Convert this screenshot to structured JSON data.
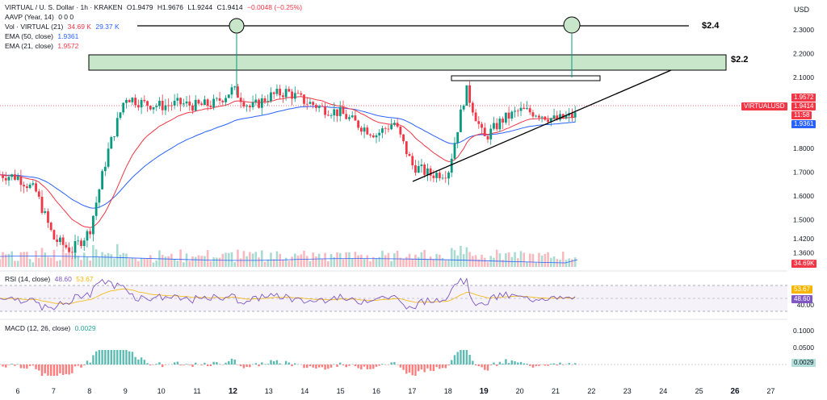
{
  "header": {
    "title": "VIRTUAL / U. S. Dollar · 1h · KRAKEN",
    "o": "O1.9479",
    "h": "H1.9676",
    "l": "L1.9244",
    "c": "C1.9414",
    "chg": "−0.0048 (−0.25%)",
    "currency": "USD"
  },
  "indicators": {
    "aavp": {
      "label": "AAVP (Year, 14)",
      "values": "0  0  0"
    },
    "vol": {
      "label": "Vol · VIRTUAL (21)",
      "v1": "34.69 K",
      "v2": "29.37 K"
    },
    "ema50": {
      "label": "EMA (50, close)",
      "value": "1.9361"
    },
    "ema21": {
      "label": "EMA (21, close)",
      "value": "1.9572"
    },
    "rsi": {
      "label": "RSI (14, close)",
      "v1": "48.60",
      "v2": "53.67"
    },
    "macd": {
      "label": "MACD (12, 26, close)",
      "value": "0.0029"
    }
  },
  "annotations": {
    "top_level": "$2.4",
    "resistance": "$2.2"
  },
  "price_tags": {
    "ema21": "1.9572",
    "symbol": "VIRTUALUSD",
    "last": "1.9414",
    "countdown": "11:58",
    "ema50": "1.9361",
    "volume": "34.69K",
    "rsi_a": "53.67",
    "rsi_b": "48.60",
    "macd": "0.0029"
  },
  "colors": {
    "up": "#089981",
    "down": "#f23645",
    "ema50": "#2962ff",
    "ema21": "#f23645",
    "rsi": "#7e57c2",
    "rsi_ma": "#f7b500",
    "zone": "#c8e6c9"
  },
  "chart_data": {
    "type": "candlestick",
    "symbol": "VIRTUAL / U. S. Dollar",
    "interval": "1h",
    "price_axis_labels": [
      "2.3000",
      "2.2000",
      "2.1000",
      "1.8000",
      "1.7000",
      "1.6000",
      "1.5000",
      "1.4200",
      "1.3600"
    ],
    "rsi_axis_labels": [
      "40.00"
    ],
    "macd_axis_labels": [
      "0.1000",
      "0.0500",
      "0.0000"
    ],
    "x_ticks": [
      "6",
      "7",
      "8",
      "9",
      "10",
      "11",
      "12",
      "13",
      "14",
      "15",
      "16",
      "17",
      "18",
      "19",
      "20",
      "21",
      "22",
      "23",
      "24",
      "25",
      "26",
      "27"
    ],
    "x_ticks_bold": [
      "12",
      "19",
      "26"
    ],
    "series_close_approx": {
      "x_day": [
        5.5,
        6.0,
        6.5,
        7.0,
        7.5,
        8.0,
        8.5,
        9.0,
        9.5,
        10.0,
        10.5,
        11.0,
        11.5,
        12.0,
        12.5,
        13.0,
        13.5,
        14.0,
        14.5,
        15.0,
        15.5,
        16.0,
        16.5,
        17.0,
        17.5,
        18.0,
        18.5,
        19.0,
        19.5,
        20.0,
        20.5,
        21.0,
        21.5
      ],
      "price": [
        1.69,
        1.68,
        1.62,
        1.42,
        1.37,
        1.45,
        1.78,
        2.02,
        1.99,
        1.98,
        1.99,
        1.98,
        1.99,
        2.05,
        1.97,
        2.02,
        2.04,
        2.0,
        1.97,
        1.95,
        1.9,
        1.86,
        1.91,
        1.73,
        1.69,
        1.7,
        2.05,
        1.84,
        1.92,
        1.96,
        1.95,
        1.92,
        1.94
      ]
    },
    "levels": {
      "top": 2.4,
      "resistance_zone": [
        2.17,
        2.22
      ]
    }
  }
}
